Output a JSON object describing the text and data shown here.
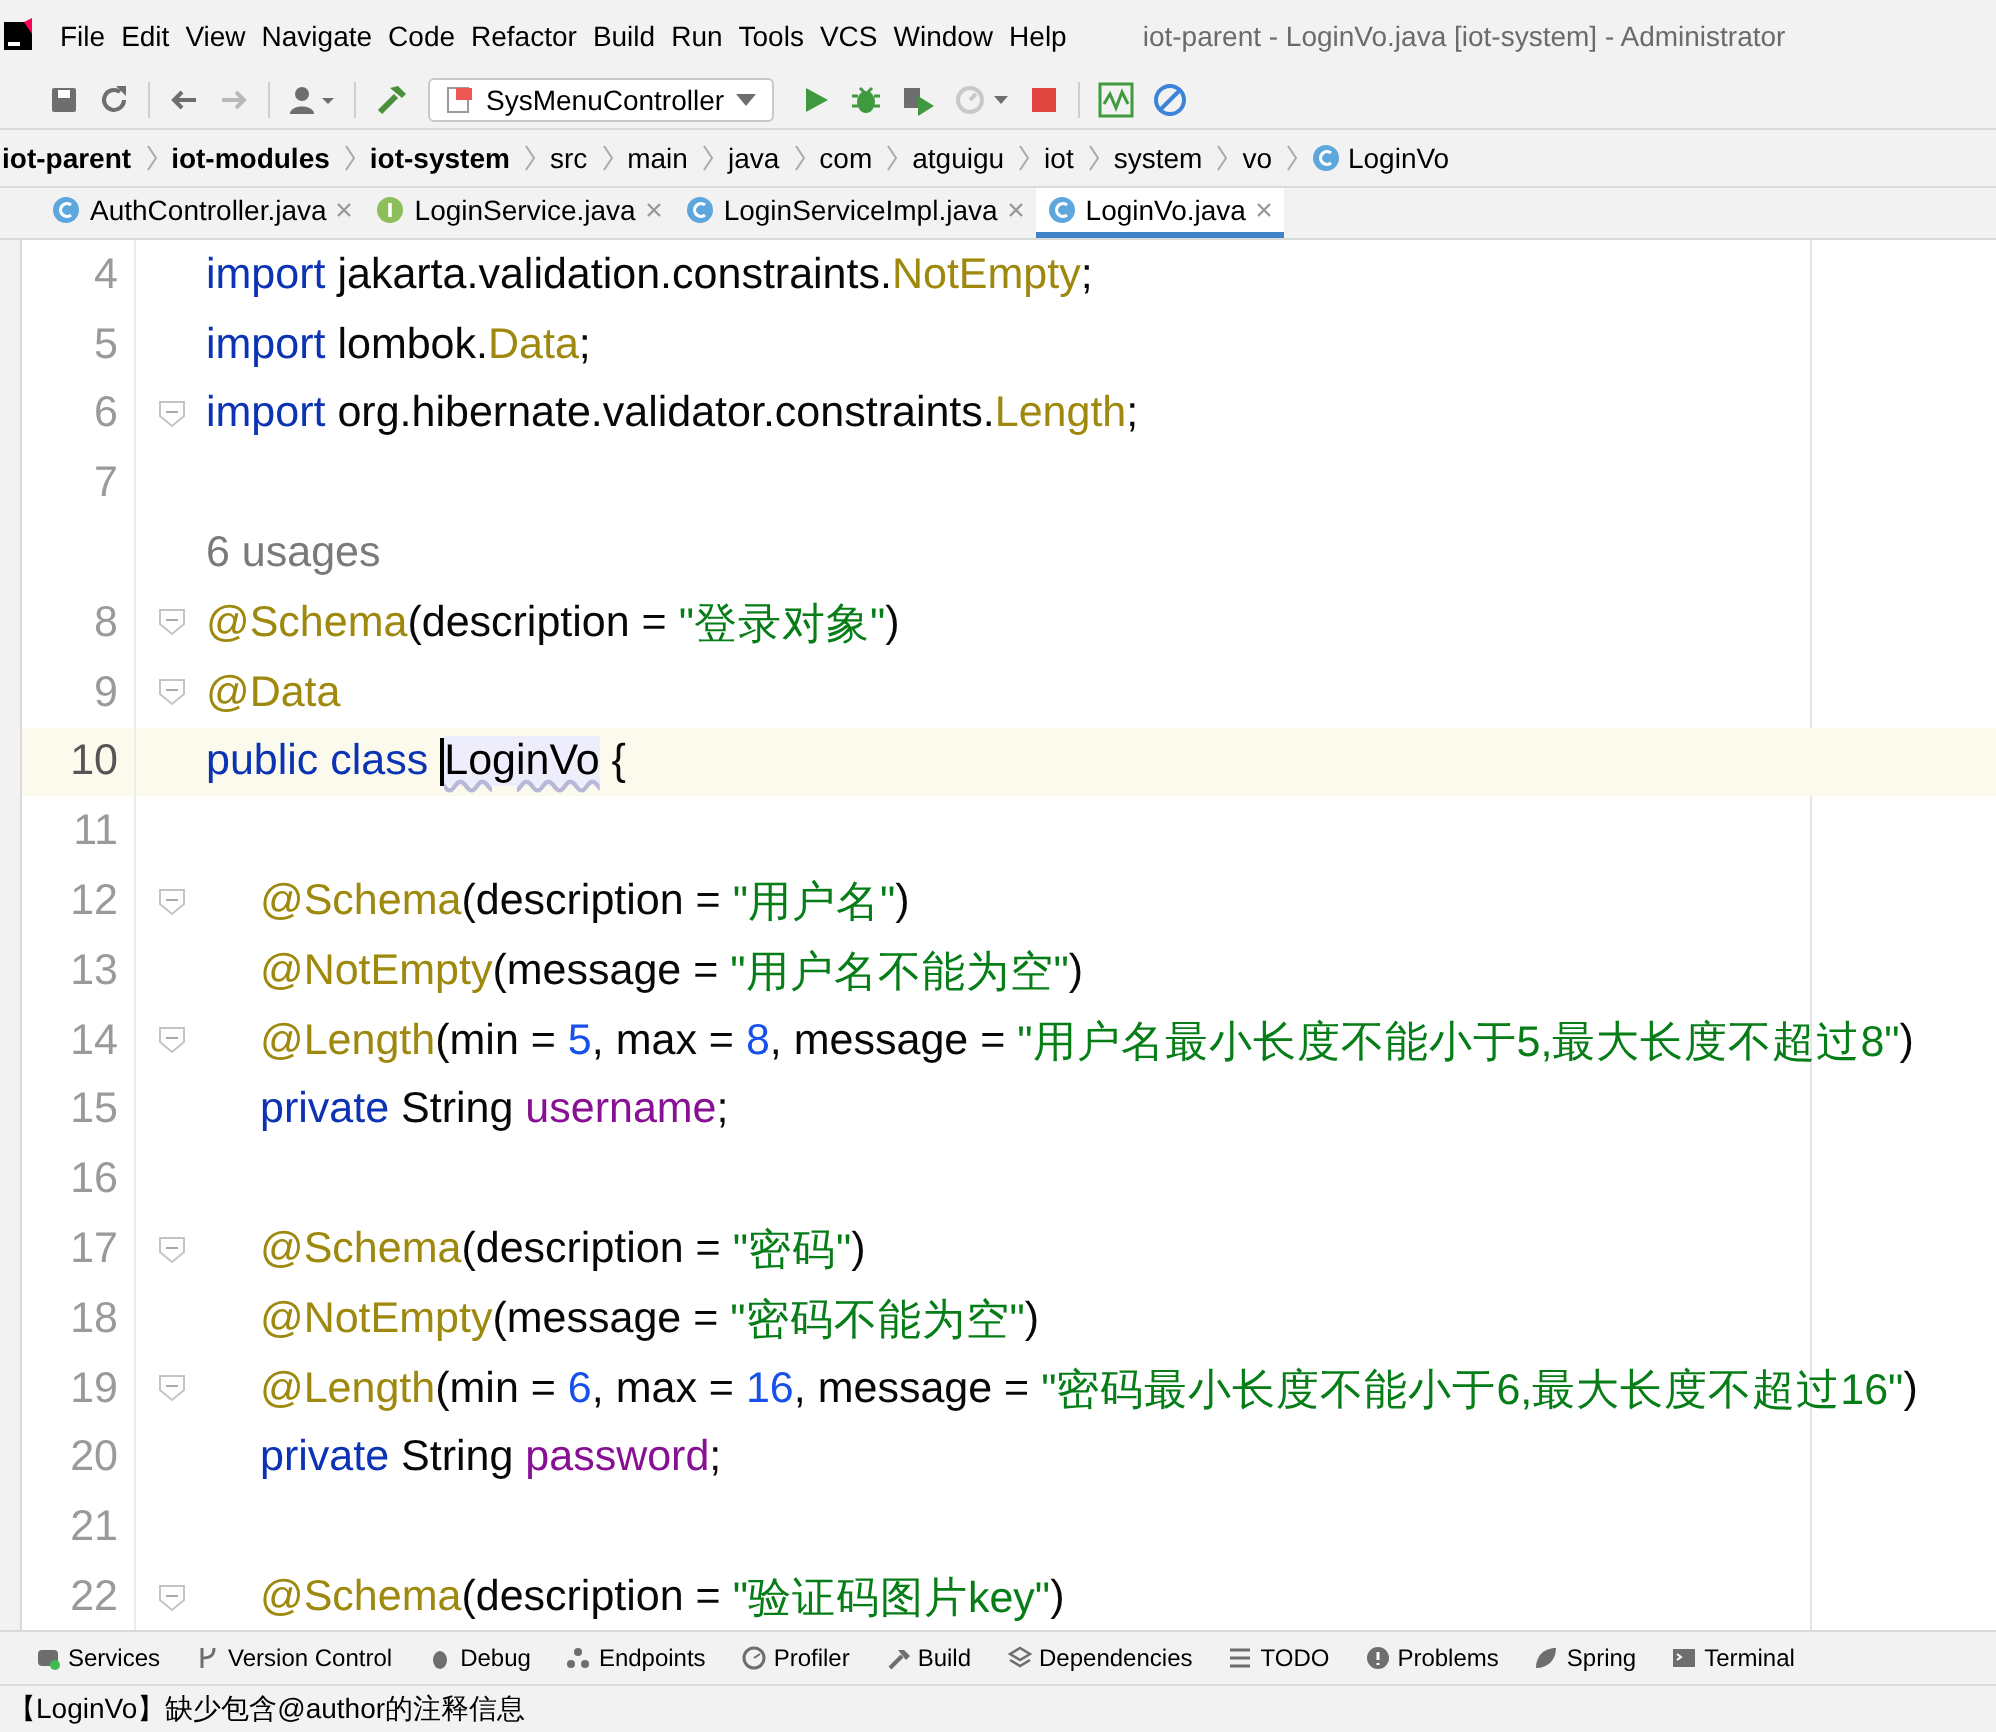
{
  "window": {
    "title": "iot-parent - LoginVo.java [iot-system] - Administrator"
  },
  "menu": [
    "File",
    "Edit",
    "View",
    "Navigate",
    "Code",
    "Refactor",
    "Build",
    "Run",
    "Tools",
    "VCS",
    "Window",
    "Help"
  ],
  "toolbar": {
    "run_config": "SysMenuController"
  },
  "breadcrumb": [
    {
      "label": "iot-parent",
      "kind": "module"
    },
    {
      "label": "iot-modules",
      "kind": "module"
    },
    {
      "label": "iot-system",
      "kind": "module"
    },
    {
      "label": "src",
      "kind": "dir"
    },
    {
      "label": "main",
      "kind": "dir"
    },
    {
      "label": "java",
      "kind": "dir"
    },
    {
      "label": "com",
      "kind": "dir"
    },
    {
      "label": "atguigu",
      "kind": "dir"
    },
    {
      "label": "iot",
      "kind": "dir"
    },
    {
      "label": "system",
      "kind": "dir"
    },
    {
      "label": "vo",
      "kind": "dir"
    },
    {
      "label": "LoginVo",
      "kind": "class"
    }
  ],
  "tabs": [
    {
      "label": "AuthController.java",
      "kind": "class",
      "selected": false
    },
    {
      "label": "LoginService.java",
      "kind": "interface",
      "selected": false
    },
    {
      "label": "LoginServiceImpl.java",
      "kind": "class",
      "selected": false
    },
    {
      "label": "LoginVo.java",
      "kind": "class",
      "selected": true
    }
  ],
  "editor": {
    "lines": [
      {
        "number": "4",
        "fold": false,
        "current": false,
        "indent": false,
        "tokens": [
          {
            "kind": "keyword",
            "t": "import"
          },
          {
            "kind": "plain",
            "t": " jakarta.validation.constraints."
          },
          {
            "kind": "annotation",
            "t": "NotEmpty"
          },
          {
            "kind": "plain",
            "t": ";"
          }
        ]
      },
      {
        "number": "5",
        "fold": false,
        "current": false,
        "indent": false,
        "tokens": [
          {
            "kind": "keyword",
            "t": "import"
          },
          {
            "kind": "plain",
            "t": " lombok."
          },
          {
            "kind": "annotation",
            "t": "Data"
          },
          {
            "kind": "plain",
            "t": ";"
          }
        ]
      },
      {
        "number": "6",
        "fold": true,
        "current": false,
        "indent": false,
        "tokens": [
          {
            "kind": "keyword",
            "t": "import"
          },
          {
            "kind": "plain",
            "t": " org.hibernate.validator.constraints."
          },
          {
            "kind": "annotation",
            "t": "Length"
          },
          {
            "kind": "plain",
            "t": ";"
          }
        ]
      },
      {
        "number": "7",
        "fold": false,
        "current": false
      },
      {
        "kind": "hint",
        "text": "6 usages"
      },
      {
        "number": "8",
        "fold": true,
        "current": false,
        "indent": false,
        "tokens": [
          {
            "kind": "annotation",
            "t": "@Schema"
          },
          {
            "kind": "plain",
            "t": "(description = "
          },
          {
            "kind": "string",
            "t": "\"登录对象\""
          },
          {
            "kind": "plain",
            "t": ")"
          }
        ]
      },
      {
        "number": "9",
        "fold": true,
        "current": false,
        "indent": false,
        "tokens": [
          {
            "kind": "annotation",
            "t": "@Data"
          }
        ]
      },
      {
        "number": "10",
        "fold": false,
        "current": true,
        "indent": false,
        "tokens": [
          {
            "kind": "keyword",
            "t": "public class "
          },
          {
            "kind": "warning",
            "t": "LoginVo"
          },
          {
            "kind": "plain",
            "t": " {"
          }
        ]
      },
      {
        "number": "11",
        "fold": false,
        "current": false
      },
      {
        "number": "12",
        "fold": true,
        "current": false,
        "indent": true,
        "tokens": [
          {
            "kind": "annotation",
            "t": "@Schema"
          },
          {
            "kind": "plain",
            "t": "(description = "
          },
          {
            "kind": "string",
            "t": "\"用户名\""
          },
          {
            "kind": "plain",
            "t": ")"
          }
        ]
      },
      {
        "number": "13",
        "fold": false,
        "current": false,
        "indent": true,
        "tokens": [
          {
            "kind": "annotation",
            "t": "@NotEmpty"
          },
          {
            "kind": "plain",
            "t": "(message = "
          },
          {
            "kind": "string",
            "t": "\"用户名不能为空\""
          },
          {
            "kind": "plain",
            "t": ")"
          }
        ]
      },
      {
        "number": "14",
        "fold": true,
        "current": false,
        "indent": true,
        "tokens": [
          {
            "kind": "annotation",
            "t": "@Length"
          },
          {
            "kind": "plain",
            "t": "(min = "
          },
          {
            "kind": "number",
            "t": "5"
          },
          {
            "kind": "plain",
            "t": ", max = "
          },
          {
            "kind": "number",
            "t": "8"
          },
          {
            "kind": "plain",
            "t": ", message = "
          },
          {
            "kind": "string",
            "t": "\"用户名最小长度不能小于5,最大长度不超过8\""
          },
          {
            "kind": "plain",
            "t": ")"
          }
        ]
      },
      {
        "number": "15",
        "fold": false,
        "current": false,
        "indent": true,
        "tokens": [
          {
            "kind": "keyword",
            "t": "private "
          },
          {
            "kind": "plain",
            "t": "String "
          },
          {
            "kind": "field",
            "t": "username"
          },
          {
            "kind": "plain",
            "t": ";"
          }
        ]
      },
      {
        "number": "16",
        "fold": false,
        "current": false
      },
      {
        "number": "17",
        "fold": true,
        "current": false,
        "indent": true,
        "tokens": [
          {
            "kind": "annotation",
            "t": "@Schema"
          },
          {
            "kind": "plain",
            "t": "(description = "
          },
          {
            "kind": "string",
            "t": "\"密码\""
          },
          {
            "kind": "plain",
            "t": ")"
          }
        ]
      },
      {
        "number": "18",
        "fold": false,
        "current": false,
        "indent": true,
        "tokens": [
          {
            "kind": "annotation",
            "t": "@NotEmpty"
          },
          {
            "kind": "plain",
            "t": "(message = "
          },
          {
            "kind": "string",
            "t": "\"密码不能为空\""
          },
          {
            "kind": "plain",
            "t": ")"
          }
        ]
      },
      {
        "number": "19",
        "fold": true,
        "current": false,
        "indent": true,
        "tokens": [
          {
            "kind": "annotation",
            "t": "@Length"
          },
          {
            "kind": "plain",
            "t": "(min = "
          },
          {
            "kind": "number",
            "t": "6"
          },
          {
            "kind": "plain",
            "t": ", max = "
          },
          {
            "kind": "number",
            "t": "16"
          },
          {
            "kind": "plain",
            "t": ", message = "
          },
          {
            "kind": "string",
            "t": "\"密码最小长度不能小于6,最大长度不超过16\""
          },
          {
            "kind": "plain",
            "t": ")"
          }
        ]
      },
      {
        "number": "20",
        "fold": false,
        "current": false,
        "indent": true,
        "tokens": [
          {
            "kind": "keyword",
            "t": "private "
          },
          {
            "kind": "plain",
            "t": "String "
          },
          {
            "kind": "field",
            "t": "password"
          },
          {
            "kind": "plain",
            "t": ";"
          }
        ]
      },
      {
        "number": "21",
        "fold": false,
        "current": false
      },
      {
        "number": "22",
        "fold": true,
        "current": false,
        "indent": true,
        "tokens": [
          {
            "kind": "annotation",
            "t": "@Schema"
          },
          {
            "kind": "plain",
            "t": "(description = "
          },
          {
            "kind": "string",
            "t": "\"验证码图片key\""
          },
          {
            "kind": "plain",
            "t": ")"
          }
        ]
      }
    ]
  },
  "tool_windows": [
    {
      "label": "Services",
      "kind": "services"
    },
    {
      "label": "Version Control",
      "kind": "vcs"
    },
    {
      "label": "Debug",
      "kind": "debug"
    },
    {
      "label": "Endpoints",
      "kind": "endpoints"
    },
    {
      "label": "Profiler",
      "kind": "profiler"
    },
    {
      "label": "Build",
      "kind": "build"
    },
    {
      "label": "Dependencies",
      "kind": "deps"
    },
    {
      "label": "TODO",
      "kind": "todo"
    },
    {
      "label": "Problems",
      "kind": "problems"
    },
    {
      "label": "Spring",
      "kind": "spring"
    },
    {
      "label": "Terminal",
      "kind": "terminal"
    }
  ],
  "status_bar": {
    "message": "【LoginVo】缺少包含@author的注释信息"
  }
}
